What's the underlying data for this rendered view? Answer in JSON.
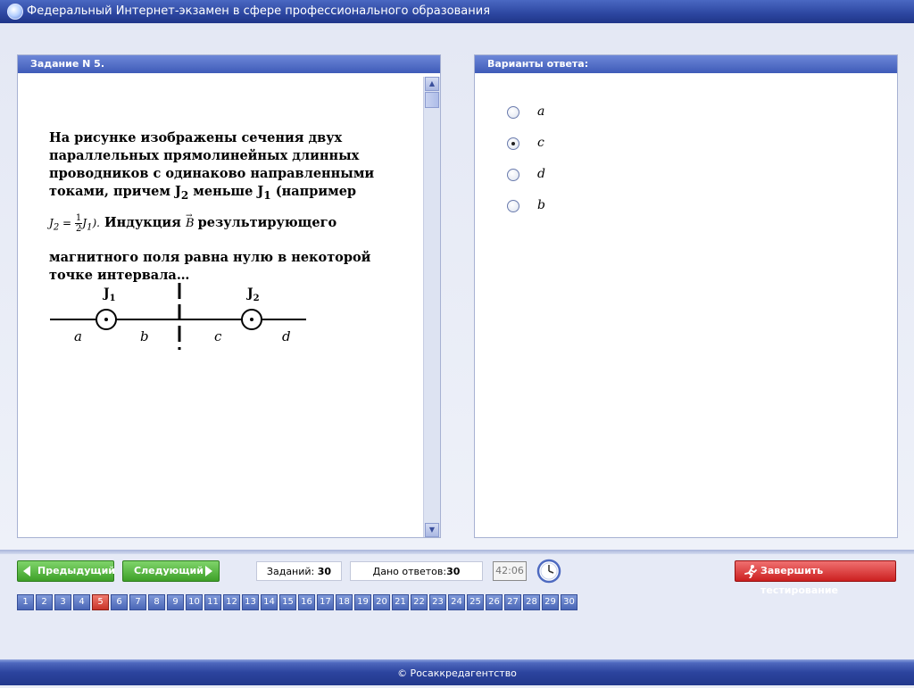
{
  "window": {
    "title": "Федеральный Интернет-экзамен в сфере профессионального образования"
  },
  "task_panel": {
    "header": "Задание N 5.",
    "question": {
      "line1": "На рисунке изображены сечения двух параллельных прямолинейных длинных проводников с одинаково направленными токами, причем J",
      "sub2": "2",
      "mid": " меньше J",
      "sub1": "1",
      "tail": " (например",
      "formula_lhs": "J",
      "formula_lhs_sub": "2",
      "formula_eq": " = ",
      "frac_num": "1",
      "frac_den": "2",
      "formula_rhs": "J",
      "formula_rhs_sub": "1",
      "formula_close": ").",
      "after_formula": " Индукция ",
      "vec_symbol": "B",
      "after_vec": " результирующего",
      "line_end": "магнитного поля равна нулю в некоторой точке интервала…"
    },
    "diagram": {
      "label_j1": "J",
      "label_j1_sub": "1",
      "label_j2": "J",
      "label_j2_sub": "2",
      "intervals": [
        "a",
        "b",
        "c",
        "d"
      ]
    }
  },
  "answer_panel": {
    "header": "Варианты ответа:",
    "options": [
      {
        "label": "a",
        "selected": false
      },
      {
        "label": "c",
        "selected": true
      },
      {
        "label": "d",
        "selected": false
      },
      {
        "label": "b",
        "selected": false
      }
    ]
  },
  "nav": {
    "prev_label": "Предыдущий",
    "next_label": "Следующий",
    "tasks_label": "Заданий: ",
    "tasks_count": "30",
    "answers_label": "Дано ответов:",
    "answers_count": "30",
    "timer": "42:06",
    "finish_label": "Завершить тестирование",
    "current_page": 5,
    "pages": [
      "1",
      "2",
      "3",
      "4",
      "5",
      "6",
      "7",
      "8",
      "9",
      "10",
      "11",
      "12",
      "13",
      "14",
      "15",
      "16",
      "17",
      "18",
      "19",
      "20",
      "21",
      "22",
      "23",
      "24",
      "25",
      "26",
      "27",
      "28",
      "29",
      "30"
    ]
  },
  "footer": {
    "text": "© Росаккредагентство"
  },
  "colors": {
    "accent": "#3e5bb8",
    "green": "#3ea028",
    "red": "#cc2020"
  }
}
